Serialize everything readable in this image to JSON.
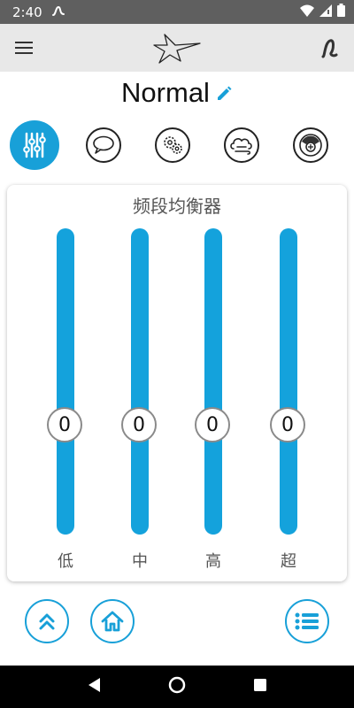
{
  "status_bar": {
    "time": "2:40"
  },
  "program": {
    "name": "Normal"
  },
  "modes": [
    {
      "name": "equalizer",
      "active": true
    },
    {
      "name": "speech",
      "active": false
    },
    {
      "name": "settings",
      "active": false
    },
    {
      "name": "wind",
      "active": false
    },
    {
      "name": "volume",
      "active": false
    }
  ],
  "equalizer": {
    "title": "频段均衡器",
    "bands": [
      {
        "label": "低",
        "value": "0"
      },
      {
        "label": "中",
        "value": "0"
      },
      {
        "label": "高",
        "value": "0"
      },
      {
        "label": "超",
        "value": "0"
      }
    ]
  },
  "colors": {
    "accent": "#18a0d8",
    "status_bar": "#5f5f5f",
    "app_bar": "#e8e8e8"
  }
}
